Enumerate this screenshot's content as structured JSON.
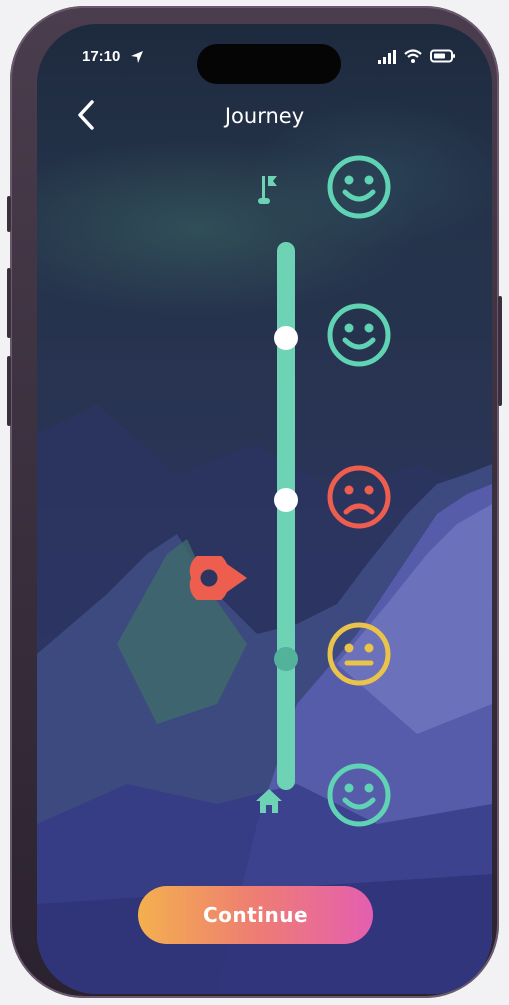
{
  "status_bar": {
    "time": "17:10"
  },
  "nav": {
    "title": "Journey",
    "back_icon": "chevron-left-icon"
  },
  "journey": {
    "start_icon": "flag-icon",
    "end_icon": "home-icon",
    "current_marker_icon": "location-pin-icon",
    "moods": [
      {
        "mood": "happy",
        "color": "#5fd3b3"
      },
      {
        "mood": "happy",
        "color": "#5fd3b3"
      },
      {
        "mood": "sad",
        "color": "#ee5e4f"
      },
      {
        "mood": "neutral",
        "color": "#e9c34a"
      },
      {
        "mood": "happy",
        "color": "#5fd3b3"
      }
    ]
  },
  "footer": {
    "continue_label": "Continue"
  },
  "colors": {
    "track": "#6ed2b4",
    "marker": "#ee5e4f",
    "button_gradient": [
      "#f4b04e",
      "#e45fb0"
    ]
  }
}
